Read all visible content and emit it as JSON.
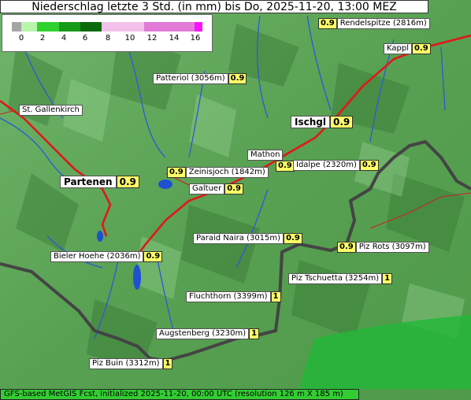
{
  "title": "Niederschlag letzte 3 Std. (in mm) bis Do, 2025-11-20, 13:00 MEZ",
  "legend": {
    "ticks": [
      "0",
      "2",
      "4",
      "6",
      "8",
      "10",
      "12",
      "14",
      "16"
    ],
    "colors": [
      "#aaaaaa",
      "#b9f5b0",
      "#33dd33",
      "#119911",
      "#0a6a0a",
      "#f0b8e8",
      "#e070d8",
      "#ff00ff"
    ]
  },
  "places": [
    {
      "name": "Rendelspitze (2816m)",
      "value": "0.9"
    },
    {
      "name": "Kappl",
      "value": "0.9"
    },
    {
      "name": "Patteriol (3056m)",
      "value": "0.9"
    },
    {
      "name": "St. Gallenkirch",
      "value": ""
    },
    {
      "name": "Ischgl",
      "value": "0.9"
    },
    {
      "name": "Mathon",
      "value": ""
    },
    {
      "name": "Idalpe (2320m)",
      "value": "0.9"
    },
    {
      "name": "Zeinisjoch (1842m)",
      "value": "0.9"
    },
    {
      "name": "Partenen",
      "value": "0.9"
    },
    {
      "name": "Galtuer",
      "value": "0.9"
    },
    {
      "name": "Paraid Naira (3015m)",
      "value": "0.9"
    },
    {
      "name": "Piz Rots (3097m)",
      "value": "0.9"
    },
    {
      "name": "Bieler Hoehe (2036m)",
      "value": "0.9"
    },
    {
      "name": "Piz Tschuetta (3254m)",
      "value": "1"
    },
    {
      "name": "Fluchthorn (3399m)",
      "value": "1"
    },
    {
      "name": "Augstenberg (3230m)",
      "value": "1"
    },
    {
      "name": "Piz Buin (3312m)",
      "value": "1"
    },
    {
      "name": "Mathon value",
      "value": "0.9"
    }
  ],
  "footer": "GFS-based MetGIS Fcst, initialized 2025-11-20, 00:00 UTC  (resolution 126 m X 185 m)"
}
